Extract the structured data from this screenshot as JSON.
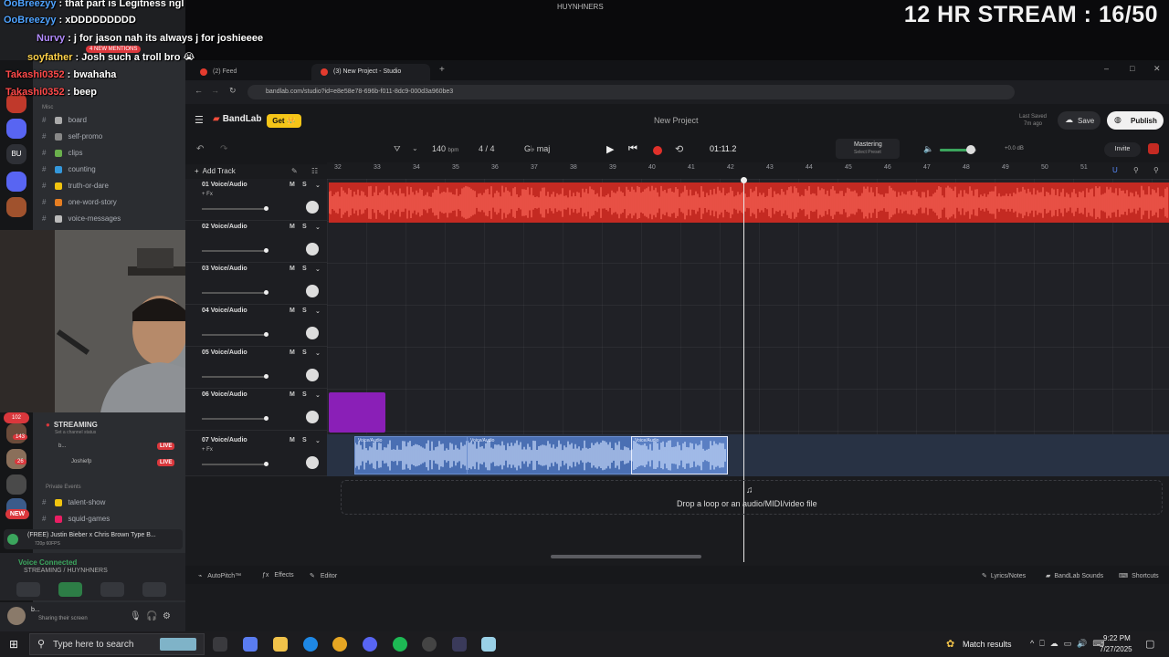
{
  "stream": {
    "title": "12 HR STREAM : 16/50",
    "center_user": "HUYNHNERS"
  },
  "chat": [
    {
      "user": "OoBreezyy",
      "message": ": that part is Legitness ngl",
      "color": "#4fa3ff"
    },
    {
      "user": "OoBreezyy",
      "message": ": xDDDDDDDDD",
      "color": "#4fa3ff"
    },
    {
      "user": "Nurvy",
      "message": ": j for jason nah its always j for joshieeee",
      "color": "#b38cff"
    },
    {
      "user": "soyfather",
      "message": ": Josh such a troll bro 😭",
      "color": "#ffd24a"
    },
    {
      "user": "Takashi0352",
      "message": ": bwahaha",
      "color": "#ff4a4a"
    },
    {
      "user": "Takashi0352",
      "message": ": beep",
      "color": "#ff4a4a"
    }
  ],
  "discord": {
    "server_label": "HUYNHNERS",
    "mentions_badge": "4 NEW MENTIONS",
    "server_letters": "BU",
    "category_misc": "Misc",
    "channels": [
      "board",
      "self-promo",
      "clips",
      "counting",
      "truth-or-dare",
      "one-word-story",
      "voice-messages"
    ],
    "private_category": "Private Events",
    "private_channels": [
      "talent-show",
      "squid-games"
    ],
    "streaming_label": "STREAMING",
    "channel_status": "Set a channel status",
    "voice_users": [
      "b...",
      "Joshiefp"
    ],
    "live_badge": "LIVE",
    "server_counts": [
      "102",
      "143",
      "26"
    ],
    "new_badge": "NEW",
    "now_playing": "(FREE) Justin Bieber x Chris Brown Type B...",
    "now_playing_sub": "720p 60FPS",
    "voice_connected": "Voice Connected",
    "voice_channel": "STREAMING / HUYNHNERS",
    "user_name": "b...",
    "user_status": "Sharing their screen"
  },
  "browser": {
    "tabs": [
      {
        "label": "(2) Feed"
      },
      {
        "label": "(3) New Project - Studio"
      }
    ],
    "url": "bandlab.com/studio?id=e8e58e78-696b-f011-8dc9-000d3a960be3"
  },
  "bandlab": {
    "logo": "BandLab",
    "get_label": "Get 👑",
    "project_title": "New Project",
    "last_saved": "Last Saved",
    "last_saved_ago": "7m ago",
    "save_label": "Save",
    "publish_label": "Publish",
    "bpm": "140",
    "bpm_unit": "bpm",
    "time_sig": "4 / 4",
    "key": "G♭ maj",
    "time": "01:11.2",
    "mastering": "Mastering",
    "mastering_sub": "Select Preset",
    "volume_db": "+0.0 dB",
    "volume_level": 0.85,
    "invite_label": "Invite",
    "add_track": "Add Track",
    "bar_numbers": [
      "32",
      "33",
      "34",
      "35",
      "36",
      "37",
      "38",
      "39",
      "40",
      "41",
      "42",
      "43",
      "44",
      "45",
      "46",
      "47",
      "48",
      "49",
      "50",
      "51"
    ],
    "tracks": [
      {
        "name": "01  Voice/Audio",
        "fx": "+ Fx"
      },
      {
        "name": "02  Voice/Audio",
        "fx": ""
      },
      {
        "name": "03  Voice/Audio",
        "fx": ""
      },
      {
        "name": "04  Voice/Audio",
        "fx": ""
      },
      {
        "name": "05  Voice/Audio",
        "fx": ""
      },
      {
        "name": "06  Voice/Audio",
        "fx": ""
      },
      {
        "name": "07  Voice/Audio",
        "fx": "+ Fx"
      }
    ],
    "mute_label": "M",
    "solo_label": "S",
    "clip_label": "Voice/Audio",
    "drop_text": "Drop a loop or an audio/MIDI/video file",
    "bottom_tools": [
      "AutoPitch™",
      "Effects",
      "Editor"
    ],
    "bottom_right": [
      "Lyrics/Notes",
      "BandLab Sounds",
      "Shortcuts"
    ]
  },
  "taskbar": {
    "search_placeholder": "Type here to search",
    "match_results": "Match results",
    "time": "9:22 PM",
    "date": "7/27/2025"
  },
  "colors": {
    "red_track": "#c42a22",
    "blue_track": "#4a6fb3",
    "purple_clip": "#8a1fb7",
    "accent": "#f5c518"
  }
}
